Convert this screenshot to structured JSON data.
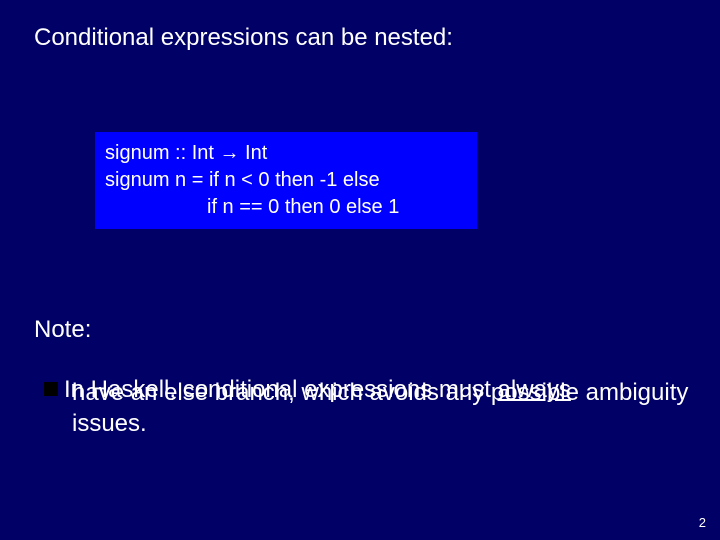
{
  "heading": "Conditional expressions can be nested:",
  "code": {
    "line1_a": "signum  :: Int ",
    "arrow": "→",
    "line1_b": " Int",
    "line2": "signum n = if n < 0 then -1 else",
    "line3": "if n == 0 then 0 else 1"
  },
  "note_label": "Note:",
  "bullet": {
    "prefix": "In Haskell, conditional expressions must ",
    "underlined": "always",
    "suffix": " have an else branch, which avoids any possible ambiguity issues."
  },
  "page_number": "2"
}
